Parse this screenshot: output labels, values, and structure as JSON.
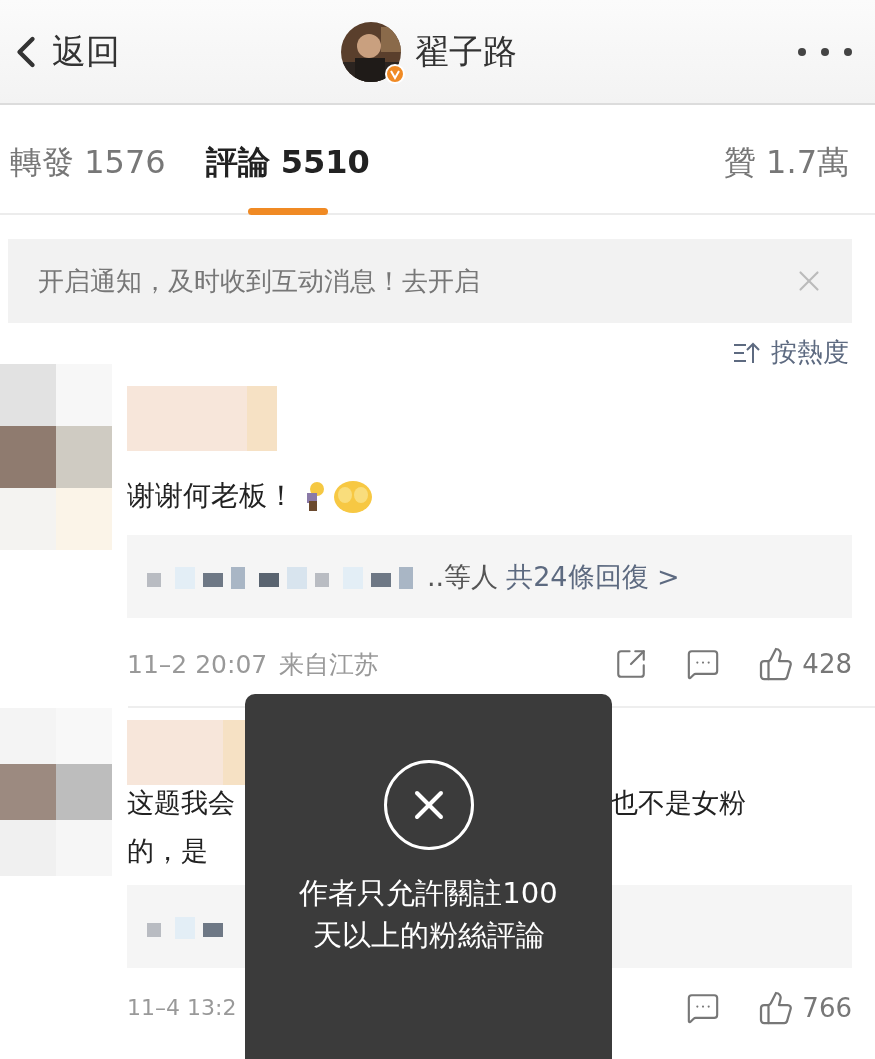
{
  "header": {
    "back_label": "返回",
    "title": "翟子路"
  },
  "tabs": [
    {
      "label": "轉發",
      "count": "1576",
      "selected": false
    },
    {
      "label": "評論",
      "count": "5510",
      "selected": true
    },
    {
      "label": "贊",
      "count": "1.7萬",
      "selected": false
    }
  ],
  "notice": {
    "text": "开启通知，及时收到互动消息！去开启"
  },
  "sort": {
    "label": "按熱度"
  },
  "comments": [
    {
      "kind": "full",
      "text": "谢谢何老板！",
      "replies_suffix": "..等人",
      "replies_link": "共24條回復 >",
      "time": "11–2 20:07",
      "location": "来自江苏",
      "likes": "428"
    },
    {
      "kind": "covered",
      "line_1_left": "这题我会",
      "line_1_right": "也不是女粉",
      "line_2_left": "的，是",
      "time": "11–4 13:2",
      "likes": "766"
    }
  ],
  "toast": {
    "lines": [
      "作者只允許關註100",
      "天以上的粉絲評論"
    ]
  }
}
